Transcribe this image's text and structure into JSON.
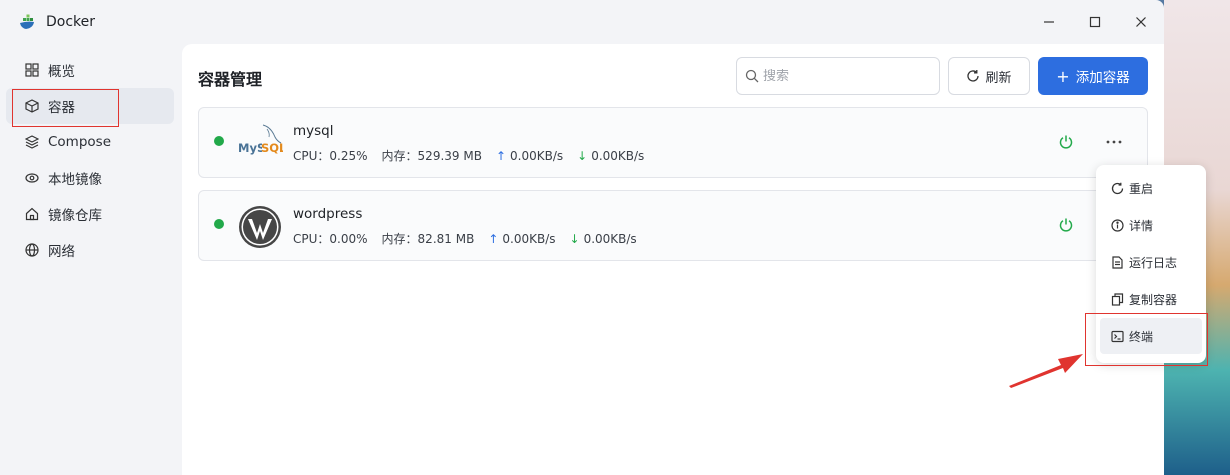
{
  "colors": {
    "accent": "#2d6ee0",
    "running": "#22a94a",
    "highlight": "#e0342f"
  },
  "app": {
    "title": "Docker",
    "icon": "docker-whale-icon"
  },
  "window_controls": {
    "minimize": "—",
    "maximize": "☐",
    "close": "✕"
  },
  "sidebar": {
    "items": [
      {
        "label": "概览",
        "icon": "grid-icon"
      },
      {
        "label": "容器",
        "icon": "cube-icon"
      },
      {
        "label": "Compose",
        "icon": "layers-icon"
      },
      {
        "label": "本地镜像",
        "icon": "eye-icon"
      },
      {
        "label": "镜像仓库",
        "icon": "home-icon"
      },
      {
        "label": "网络",
        "icon": "globe-icon"
      }
    ],
    "active_index": 1
  },
  "main": {
    "title": "容器管理",
    "search": {
      "placeholder": "搜索",
      "value": ""
    },
    "refresh_label": "刷新",
    "add_label": "添加容器",
    "containers": [
      {
        "name": "mysql",
        "logo": "mysql-logo",
        "status": "running",
        "cpu_label": "CPU：",
        "cpu": "0.25%",
        "mem_label": "内存：",
        "mem": "529.39 MB",
        "up": "0.00KB/s",
        "down": "0.00KB/s"
      },
      {
        "name": "wordpress",
        "logo": "wordpress-logo",
        "status": "running",
        "cpu_label": "CPU：",
        "cpu": "0.00%",
        "mem_label": "内存：",
        "mem": "82.81 MB",
        "up": "0.00KB/s",
        "down": "0.00KB/s"
      }
    ]
  },
  "context_menu": {
    "items": [
      {
        "label": "重启",
        "icon": "restart-icon"
      },
      {
        "label": "详情",
        "icon": "info-icon"
      },
      {
        "label": "运行日志",
        "icon": "log-file-icon"
      },
      {
        "label": "复制容器",
        "icon": "copy-icon"
      },
      {
        "label": "终端",
        "icon": "terminal-icon"
      }
    ],
    "hovered_index": 4
  },
  "logos": {
    "mysql_text": "MySQL"
  }
}
